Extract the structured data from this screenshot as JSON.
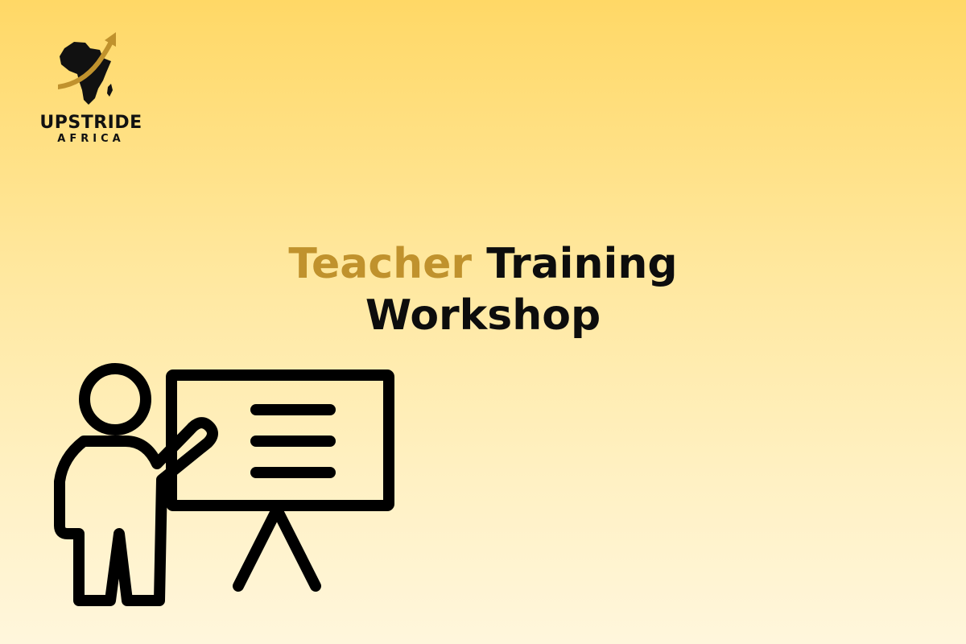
{
  "brand": {
    "name": "UPSTRIDE",
    "sub": "AFRICA",
    "accent_color": "#c0922d"
  },
  "headline": {
    "word_accent": "Teacher",
    "word_rest": "Training",
    "line2": "Workshop"
  },
  "illustration": {
    "icon": "teacher-presentation-icon"
  }
}
